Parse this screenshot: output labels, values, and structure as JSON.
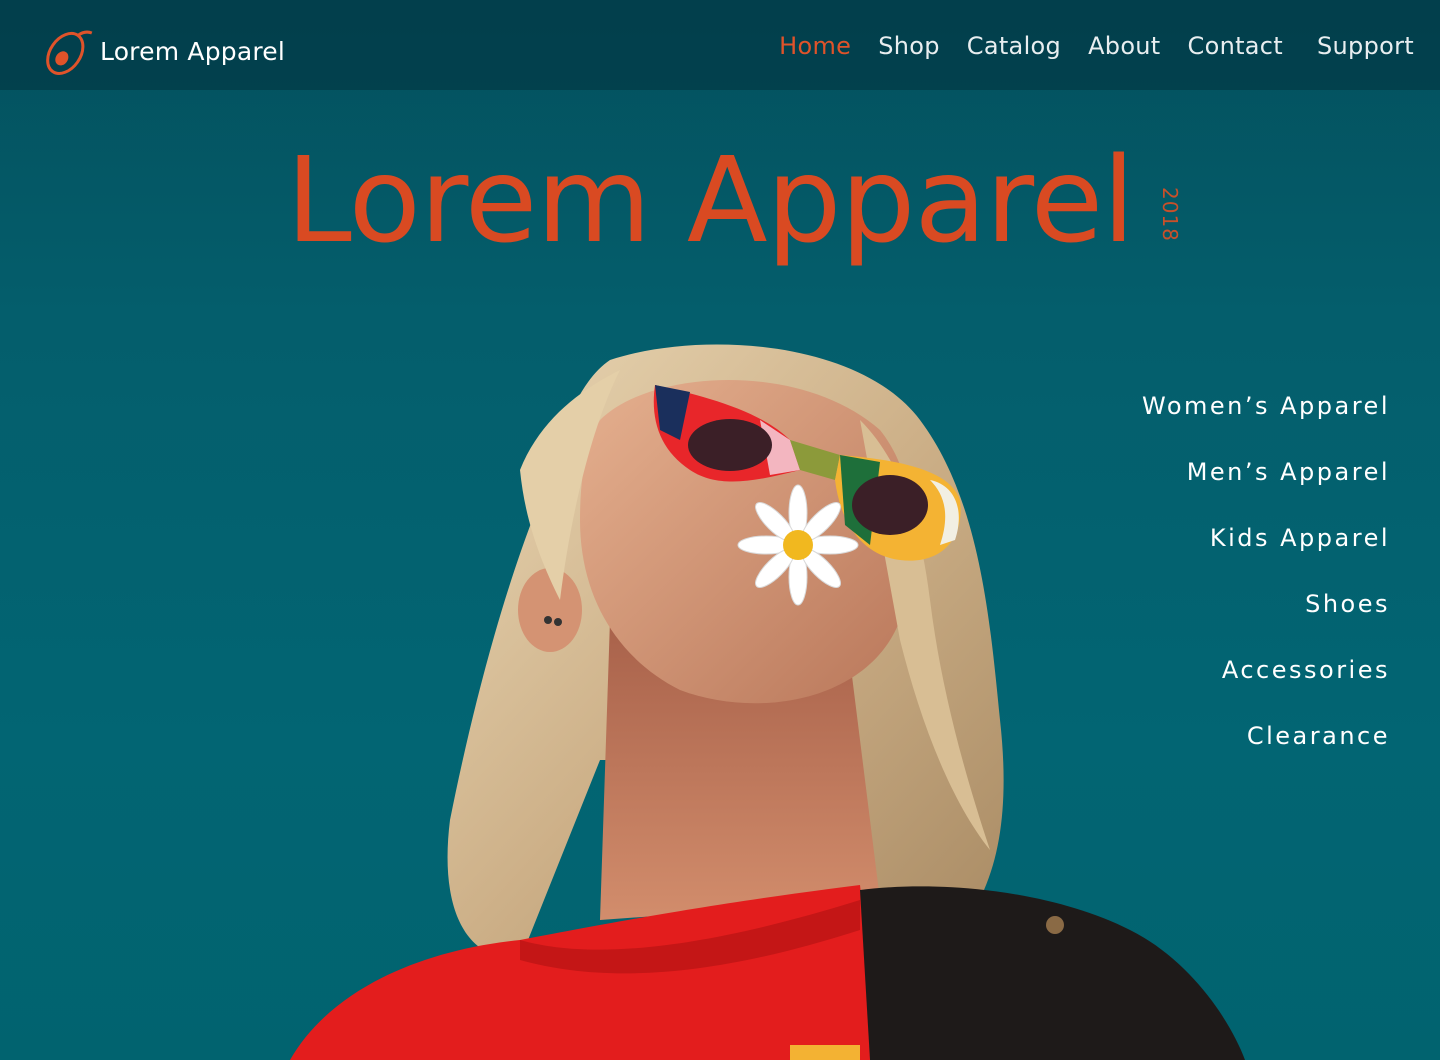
{
  "brand": {
    "name": "Lorem Apparel",
    "logo_icon": "avocado-logo-icon",
    "accent": "#e0532a"
  },
  "nav": {
    "items": [
      {
        "label": "Home",
        "active": true
      },
      {
        "label": "Shop",
        "active": false
      },
      {
        "label": "Catalog",
        "active": false
      },
      {
        "label": "About",
        "active": false
      },
      {
        "label": "Contact",
        "active": false
      },
      {
        "label": "Support",
        "active": false
      }
    ]
  },
  "hero": {
    "title": "Lorem Apparel",
    "year": "2018",
    "title_color": "#d94a22"
  },
  "categories": {
    "items": [
      {
        "label": "Women’s Apparel"
      },
      {
        "label": "Men’s Apparel"
      },
      {
        "label": "Kids Apparel"
      },
      {
        "label": "Shoes"
      },
      {
        "label": "Accessories"
      },
      {
        "label": "Clearance"
      }
    ]
  },
  "colors": {
    "background": "#025c6b",
    "topbar": "#03394a",
    "text": "#ffffff"
  }
}
